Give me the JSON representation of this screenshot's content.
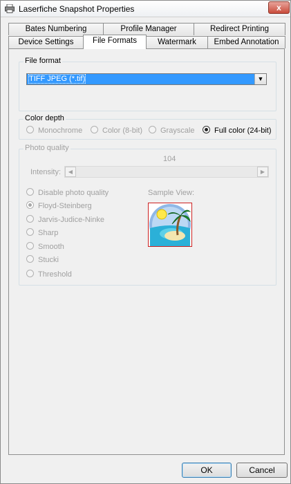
{
  "window": {
    "title": "Laserfiche Snapshot Properties",
    "close_glyph": "x"
  },
  "tabs": {
    "row1": [
      "Bates Numbering",
      "Profile Manager",
      "Redirect Printing"
    ],
    "row2": [
      "Device Settings",
      "File Formats",
      "Watermark",
      "Embed Annotation"
    ],
    "active": "File Formats"
  },
  "file_format": {
    "label": "File format",
    "selected": "TIFF JPEG (*.tif)"
  },
  "color_depth": {
    "label": "Color depth",
    "options": [
      "Monochrome",
      "Color (8-bit)",
      "Grayscale",
      "Full color (24-bit)"
    ],
    "selected": "Full color (24-bit)"
  },
  "photo_quality": {
    "label": "Photo quality",
    "intensity_label": "Intensity:",
    "intensity_value": "104",
    "options": [
      "Disable photo quality",
      "Floyd-Steinberg",
      "Jarvis-Judice-Ninke",
      "Sharp",
      "Smooth",
      "Stucki",
      "Threshold"
    ],
    "selected": "Floyd-Steinberg",
    "sample_label": "Sample View:"
  },
  "buttons": {
    "ok": "OK",
    "cancel": "Cancel"
  },
  "icons": {
    "app": "printer-icon",
    "close": "close-icon",
    "dropdown": "chevron-down-icon",
    "scroll_left": "arrow-left-icon",
    "scroll_right": "arrow-right-icon",
    "sample": "island-palm-image"
  },
  "colors": {
    "selection": "#3399ff",
    "close": "#c94c3c"
  }
}
